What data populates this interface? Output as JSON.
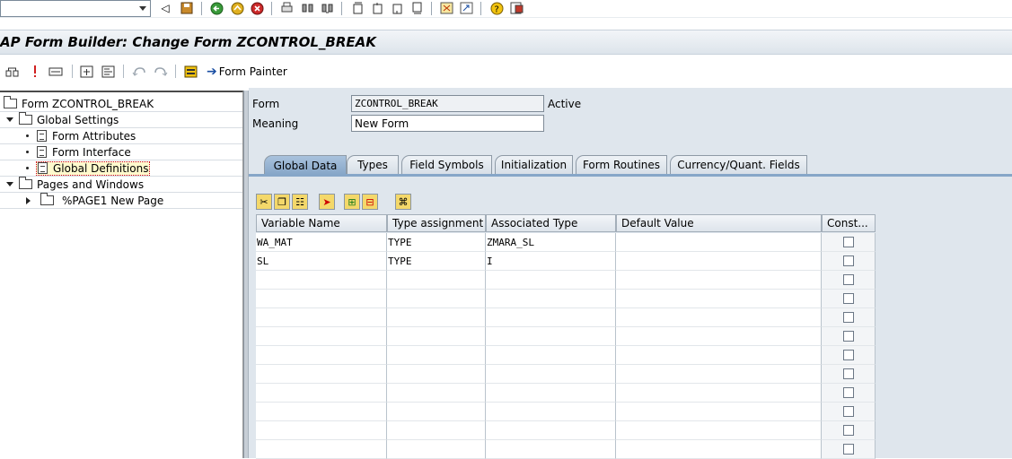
{
  "window": {
    "title": "AP Form Builder: Change Form ZCONTROL_BREAK"
  },
  "system_toolbar": {
    "command_field": {
      "value": "",
      "placeholder": ""
    },
    "icons": [
      "back-icon",
      "save-icon",
      "green-back-icon",
      "exit-icon",
      "cancel-icon",
      "print-icon",
      "find-icon",
      "find-next-icon",
      "first-page-icon",
      "prev-page-icon",
      "next-page-icon",
      "last-page-icon",
      "new-session-icon",
      "shortcut-icon",
      "help-icon",
      "layout-menu-icon"
    ]
  },
  "app_toolbar": {
    "form_painter_label": "Form Painter",
    "icons": [
      "other-object-icon",
      "check-icon",
      "test-icon",
      "form-painter-layout-icon",
      "ruler-icon",
      "undo-icon",
      "redo-icon",
      "field-list-icon"
    ]
  },
  "tree": {
    "nodes": [
      {
        "label": "Form ZCONTROL_BREAK",
        "level": 0,
        "type": "folder"
      },
      {
        "label": "Global Settings",
        "level": 1,
        "type": "folder-open",
        "expanded": true
      },
      {
        "label": "Form Attributes",
        "level": 2,
        "type": "doc"
      },
      {
        "label": "Form Interface",
        "level": 2,
        "type": "doc"
      },
      {
        "label": "Global Definitions",
        "level": 2,
        "type": "doc",
        "selected": true
      },
      {
        "label": "Pages and Windows",
        "level": 1,
        "type": "folder-open",
        "expanded": true
      },
      {
        "label": "%PAGE1 New Page",
        "level": 2,
        "type": "folder",
        "expanded": false
      }
    ]
  },
  "header_fields": {
    "form_label": "Form",
    "form_value": "ZCONTROL_BREAK",
    "status": "Active",
    "meaning_label": "Meaning",
    "meaning_value": "New Form"
  },
  "tabs": [
    {
      "label": "Global Data",
      "active": true
    },
    {
      "label": "Types",
      "active": false
    },
    {
      "label": "Field Symbols",
      "active": false
    },
    {
      "label": "Initialization",
      "active": false
    },
    {
      "label": "Form Routines",
      "active": false
    },
    {
      "label": "Currency/Quant. Fields",
      "active": false
    }
  ],
  "table_toolbar": {
    "icons": [
      "cut-icon",
      "copy-icon",
      "paste-icon",
      "insert-row-icon",
      "append-row-icon",
      "delete-row-icon",
      "type-search-icon"
    ]
  },
  "table": {
    "columns": [
      "Variable Name",
      "Type assignment",
      "Associated Type",
      "Default Value",
      "Const..."
    ],
    "rows": [
      {
        "variable": "WA_MAT",
        "assignment": "TYPE",
        "assoc_type": "ZMARA_SL",
        "default": "",
        "const": false
      },
      {
        "variable": "SL",
        "assignment": "TYPE",
        "assoc_type": "I",
        "default": "",
        "const": false
      },
      {
        "variable": "",
        "assignment": "",
        "assoc_type": "",
        "default": "",
        "const": false
      },
      {
        "variable": "",
        "assignment": "",
        "assoc_type": "",
        "default": "",
        "const": false
      },
      {
        "variable": "",
        "assignment": "",
        "assoc_type": "",
        "default": "",
        "const": false
      },
      {
        "variable": "",
        "assignment": "",
        "assoc_type": "",
        "default": "",
        "const": false
      },
      {
        "variable": "",
        "assignment": "",
        "assoc_type": "",
        "default": "",
        "const": false
      },
      {
        "variable": "",
        "assignment": "",
        "assoc_type": "",
        "default": "",
        "const": false
      },
      {
        "variable": "",
        "assignment": "",
        "assoc_type": "",
        "default": "",
        "const": false
      },
      {
        "variable": "",
        "assignment": "",
        "assoc_type": "",
        "default": "",
        "const": false
      },
      {
        "variable": "",
        "assignment": "",
        "assoc_type": "",
        "default": "",
        "const": false
      },
      {
        "variable": "",
        "assignment": "",
        "assoc_type": "",
        "default": "",
        "const": false
      }
    ]
  }
}
